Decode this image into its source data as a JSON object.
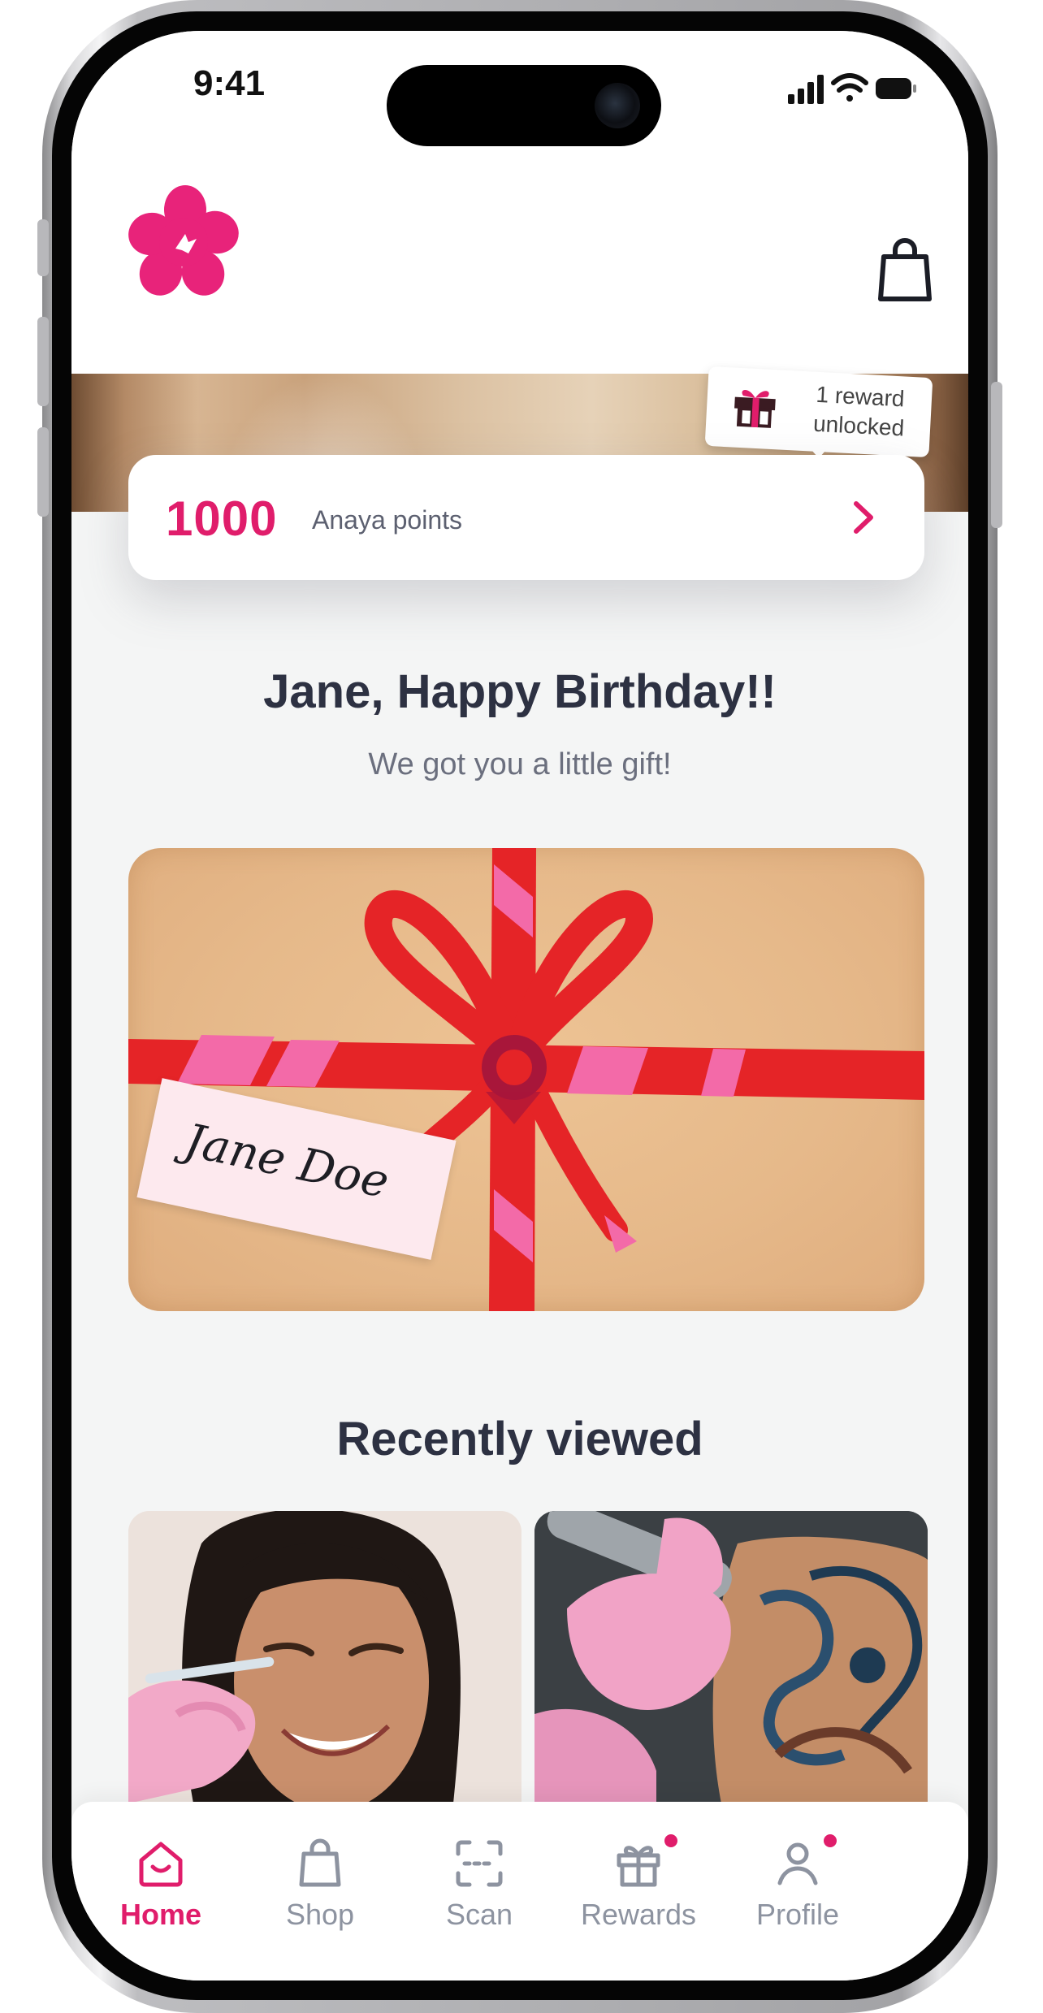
{
  "status_bar": {
    "time": "9:41",
    "icons": [
      "cellular-signal-icon",
      "wifi-icon",
      "battery-icon"
    ]
  },
  "header": {
    "logo_icon": "flower-logo-icon",
    "cart_icon": "shopping-bag-icon"
  },
  "rewards": {
    "badge_text": "1 reward\nunlocked",
    "badge_icon": "gift-box-icon",
    "points_value": "1000",
    "points_label": "Anaya points",
    "chevron_icon": "chevron-right-icon"
  },
  "greeting": {
    "title": "Jane, Happy Birthday!!",
    "subtitle": "We got you a little gift!"
  },
  "gift_card": {
    "name_tag": "Jane Doe"
  },
  "recently_viewed": {
    "title": "Recently viewed",
    "items": [
      {
        "image": "injection-treatment-photo"
      },
      {
        "image": "tattoo-removal-photo"
      }
    ]
  },
  "bottom_nav": {
    "items": [
      {
        "label": "Home",
        "icon": "home-icon",
        "active": true,
        "badge": false
      },
      {
        "label": "Shop",
        "icon": "shopping-bag-icon",
        "active": false,
        "badge": false
      },
      {
        "label": "Scan",
        "icon": "scan-icon",
        "active": false,
        "badge": false
      },
      {
        "label": "Rewards",
        "icon": "gift-icon",
        "active": false,
        "badge": true
      },
      {
        "label": "Profile",
        "icon": "profile-icon",
        "active": false,
        "badge": true
      }
    ]
  },
  "colors": {
    "brand": "#e01d6b",
    "text_dark": "#2d3142",
    "text_muted": "#6b6f7e",
    "nav_inactive": "#8d93a0",
    "background": "#f4f5f5"
  }
}
